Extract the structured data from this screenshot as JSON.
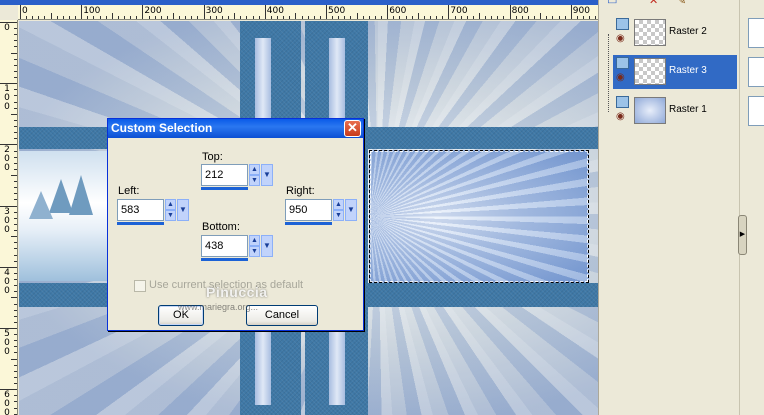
{
  "ruler": {
    "h_labels": [
      "0",
      "100",
      "200",
      "300",
      "400",
      "500",
      "600",
      "700",
      "800",
      "900"
    ],
    "v_labels": [
      "0",
      "1 0 0",
      "2 0 0",
      "3 0 0",
      "4 0 0",
      "5 0 0",
      "6 0 0"
    ]
  },
  "dialog": {
    "title": "Custom Selection",
    "close_symbol": "✕",
    "top": {
      "label": "Top:",
      "value": "212"
    },
    "left": {
      "label": "Left:",
      "value": "583"
    },
    "right": {
      "label": "Right:",
      "value": "950"
    },
    "bottom": {
      "label": "Bottom:",
      "value": "438"
    },
    "checkbox_label": "Use current selection as default",
    "ok_label": "OK",
    "cancel_label": "Cancel"
  },
  "watermark": {
    "name": "Pinuccia",
    "url": "www.mariegra.org..."
  },
  "layers": {
    "items": [
      {
        "name": "Raster 2",
        "selected": false
      },
      {
        "name": "Raster 3",
        "selected": true
      },
      {
        "name": "Raster 1",
        "selected": false
      }
    ]
  },
  "colors": {
    "titlebar": "#0a5ae8",
    "selection_highlight": "#316ac5",
    "denim": "#3f78a6",
    "dialog_bg": "#ece9d8"
  },
  "icons": [
    "new-layer-icon",
    "delete-layer-icon",
    "properties-icon",
    "eye-icon",
    "layer-type-icon",
    "collapse-arrow-icon",
    "spin-up-icon",
    "spin-down-icon",
    "dropdown-arrow-icon",
    "close-icon"
  ]
}
